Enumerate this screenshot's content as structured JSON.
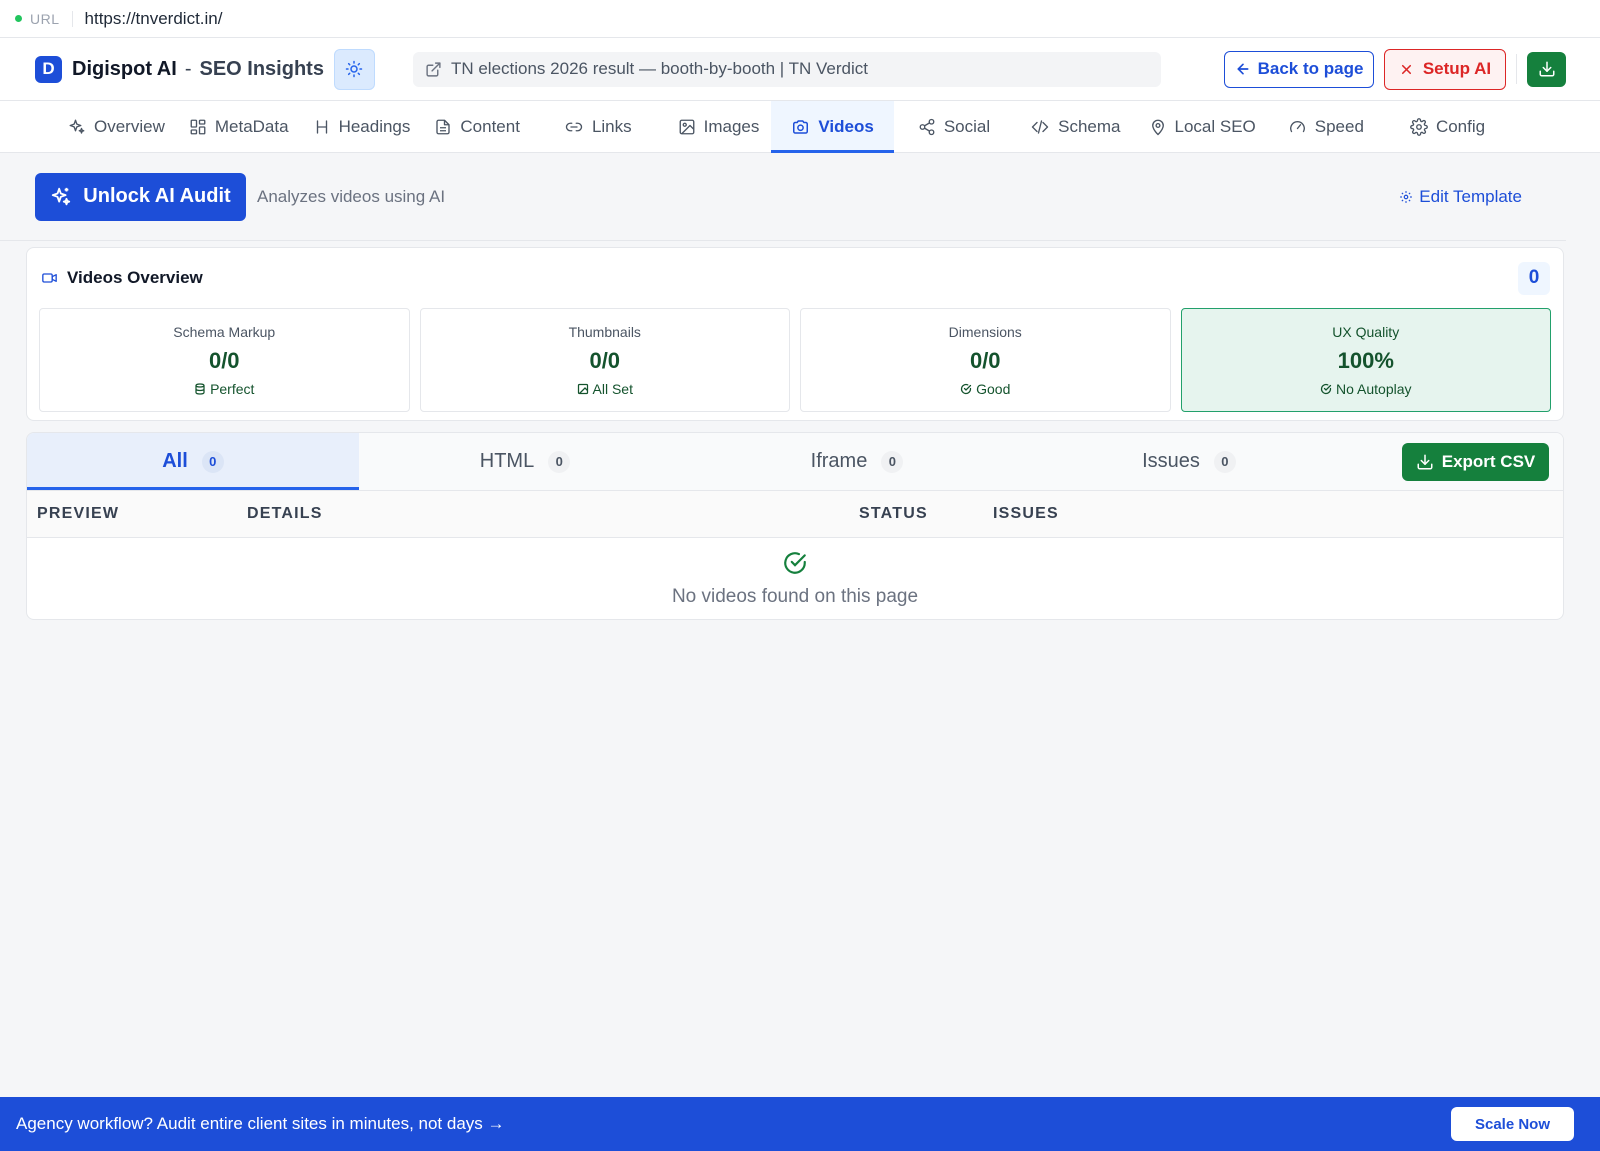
{
  "urlbar": {
    "label": "URL",
    "value": "https://tnverdict.in/"
  },
  "header": {
    "logo_letter": "D",
    "brand": "Digispot AI",
    "separator": "-",
    "product": "SEO Insights",
    "theme_icon": "sun-icon",
    "page_title": "TN elections 2026 result — booth-by-booth | TN Verdict",
    "back_label": "Back to page",
    "setup_label": "Setup AI",
    "download_icon": "download-icon"
  },
  "nav": {
    "tabs": [
      {
        "label": "Overview",
        "icon": "sparkle-icon"
      },
      {
        "label": "MetaData",
        "icon": "grid-icon"
      },
      {
        "label": "Headings",
        "icon": "heading-icon"
      },
      {
        "label": "Content",
        "icon": "document-icon"
      },
      {
        "label": "Links",
        "icon": "link-icon"
      },
      {
        "label": "Images",
        "icon": "image-icon"
      },
      {
        "label": "Videos",
        "icon": "camera-icon"
      },
      {
        "label": "Social",
        "icon": "share-icon"
      },
      {
        "label": "Schema",
        "icon": "code-icon"
      },
      {
        "label": "Local SEO",
        "icon": "map-pin-icon"
      },
      {
        "label": "Speed",
        "icon": "gauge-icon"
      },
      {
        "label": "Config",
        "icon": "gear-icon"
      }
    ],
    "active": "Videos"
  },
  "audit": {
    "unlock_label": "Unlock AI Audit",
    "subtitle": "Analyzes videos using AI",
    "edit_template_label": "Edit Template"
  },
  "overview": {
    "title": "Videos Overview",
    "count": "0",
    "stats": [
      {
        "label": "Schema Markup",
        "value": "0/0",
        "foot": "Perfect",
        "icon": "database-icon"
      },
      {
        "label": "Thumbnails",
        "value": "0/0",
        "foot": "All Set",
        "icon": "image-icon"
      },
      {
        "label": "Dimensions",
        "value": "0/0",
        "foot": "Good",
        "icon": "check-circle-icon"
      },
      {
        "label": "UX Quality",
        "value": "100%",
        "foot": "No Autoplay",
        "icon": "check-circle-icon"
      }
    ]
  },
  "videos": {
    "tabs": [
      {
        "label": "All",
        "count": "0"
      },
      {
        "label": "HTML",
        "count": "0"
      },
      {
        "label": "Iframe",
        "count": "0"
      },
      {
        "label": "Issues",
        "count": "0"
      }
    ],
    "export_label": "Export CSV",
    "columns": [
      "PREVIEW",
      "DETAILS",
      "STATUS",
      "ISSUES"
    ],
    "empty_message": "No videos found on this page"
  },
  "banner": {
    "text": "Agency workflow? Audit entire client sites in minutes, not days →",
    "cta": "Scale Now"
  },
  "colors": {
    "primary": "#1d4ed8",
    "success": "#15803d",
    "danger": "#dc2626"
  }
}
